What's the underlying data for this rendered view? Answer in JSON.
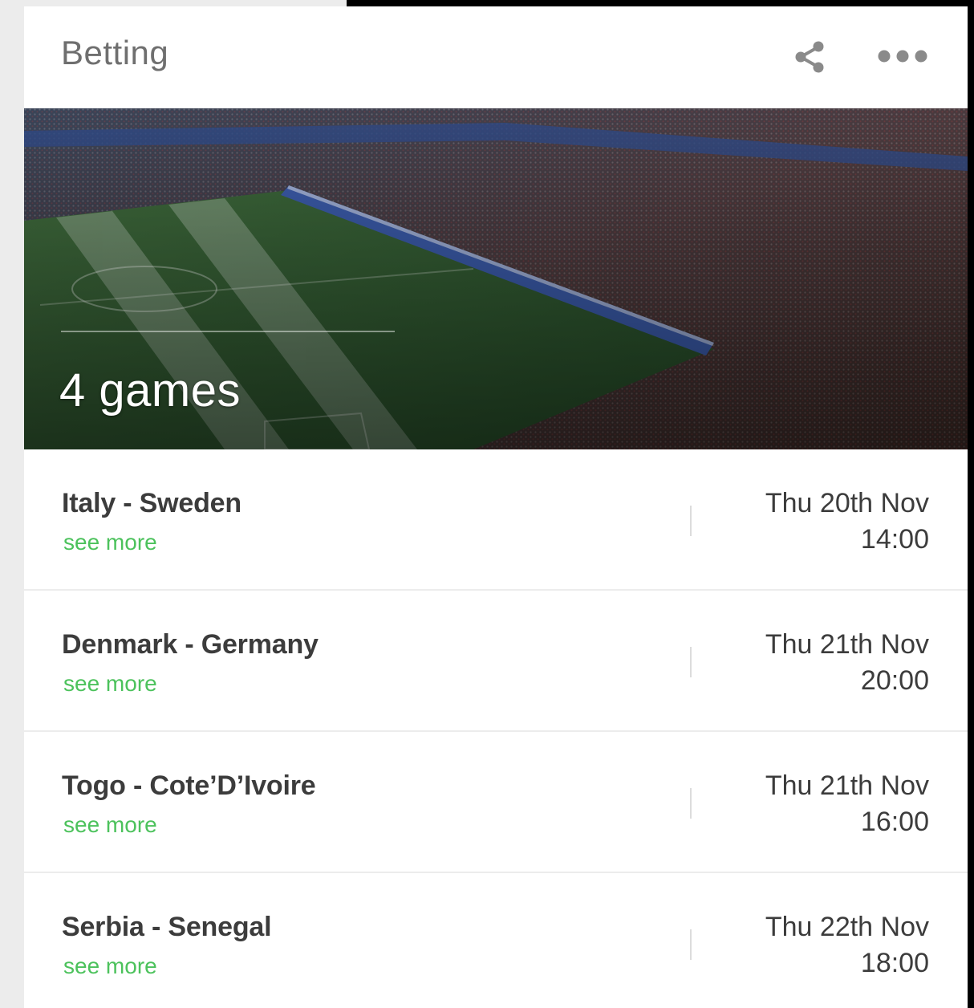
{
  "header": {
    "title": "Betting",
    "share_icon": "share-icon",
    "more_icon": "more-horizontal-icon"
  },
  "hero": {
    "game_count_label": "4 games",
    "image": "stadium-photo"
  },
  "games": [
    {
      "match": "Italy - Sweden",
      "link": "see more",
      "date": "Thu 20th Nov",
      "time": "14:00"
    },
    {
      "match": "Denmark - Germany",
      "link": "see more",
      "date": "Thu 21th Nov",
      "time": "20:00"
    },
    {
      "match": "Togo - Cote’D’Ivoire",
      "link": "see more",
      "date": "Thu 21th Nov",
      "time": "16:00"
    },
    {
      "match": "Serbia - Senegal",
      "link": "see more",
      "date": "Thu 22th Nov",
      "time": "18:00"
    }
  ],
  "colors": {
    "accent_green": "#4cc25c",
    "title_gray": "#6f6f6f",
    "text_dark": "#3c3c3c"
  }
}
